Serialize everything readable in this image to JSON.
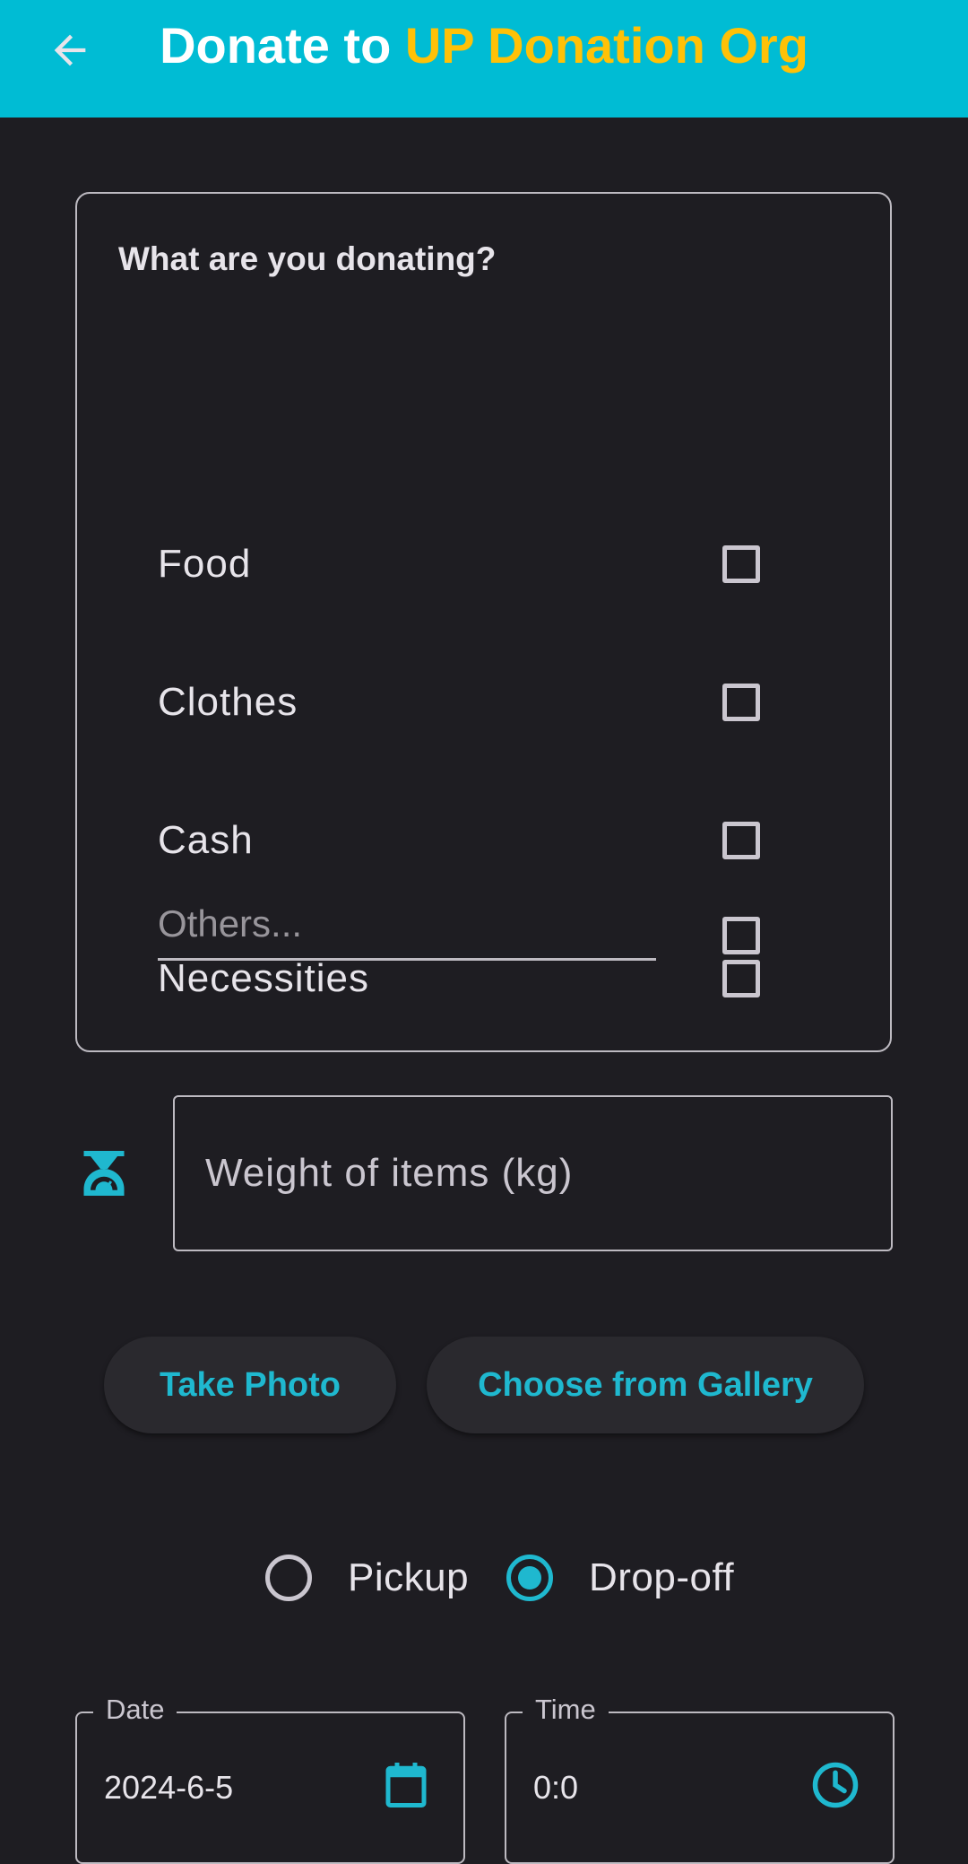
{
  "appbar": {
    "title_prefix": "Donate to ",
    "org_name": "UP Donation Org",
    "back_icon": "arrow-back-icon",
    "background_color": "#00bcd4",
    "org_color": "#ffc107"
  },
  "donation_types": {
    "title": "What are you donating?",
    "options": [
      {
        "label": "Food",
        "checked": false
      },
      {
        "label": "Clothes",
        "checked": false
      },
      {
        "label": "Cash",
        "checked": false
      },
      {
        "label": "Necessities",
        "checked": false
      }
    ],
    "others_placeholder": "Others...",
    "others_checked": false
  },
  "weight": {
    "icon": "scale-icon",
    "placeholder": "Weight of items (kg)"
  },
  "photo_buttons": {
    "take_photo": "Take Photo",
    "choose_gallery": "Choose from Gallery"
  },
  "method": {
    "options": [
      {
        "label": "Pickup",
        "selected": false
      },
      {
        "label": "Drop-off",
        "selected": true
      }
    ]
  },
  "date_field": {
    "label": "Date",
    "value": "2024-6-5",
    "icon": "calendar-icon"
  },
  "time_field": {
    "label": "Time",
    "value": "0:0",
    "icon": "clock-icon"
  },
  "accent_color": "#1fb8cf"
}
